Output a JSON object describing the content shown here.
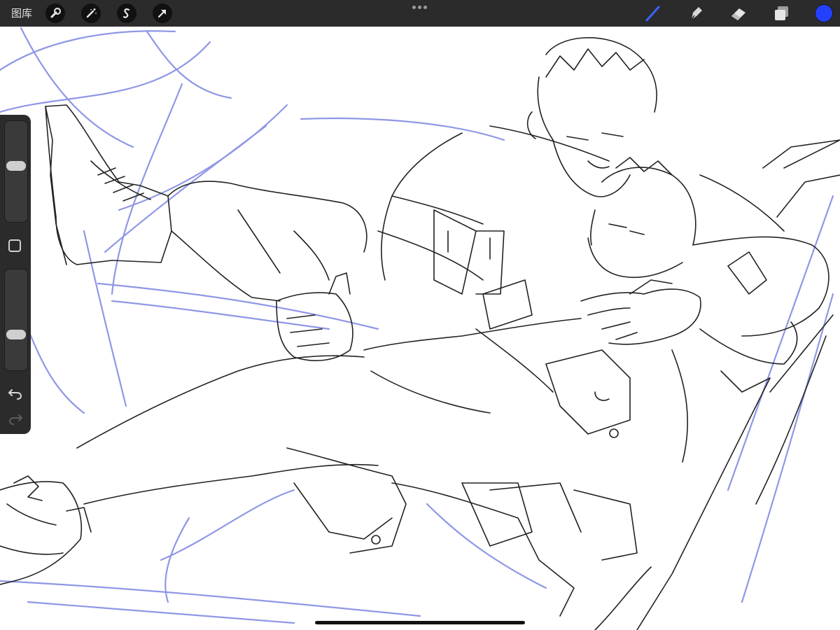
{
  "toolbar": {
    "gallery_label": "图库",
    "left_tools": [
      "wrench-icon",
      "magic-wand-icon",
      "selection-s-icon",
      "transform-arrow-icon"
    ],
    "right_tools": [
      "brush-icon",
      "smudge-icon",
      "eraser-icon",
      "layers-icon"
    ],
    "active_tool": "brush-icon",
    "current_color": "#2440ff"
  },
  "sidebar": {
    "brush_size_level": 0.56,
    "opacity_level": 0.33,
    "modify_button": "square-icon",
    "undo": "undo-icon",
    "redo": "redo-icon"
  },
  "canvas": {
    "content": "line-art",
    "sketch_color": "#8f97e6",
    "ink_color": "#222222"
  }
}
